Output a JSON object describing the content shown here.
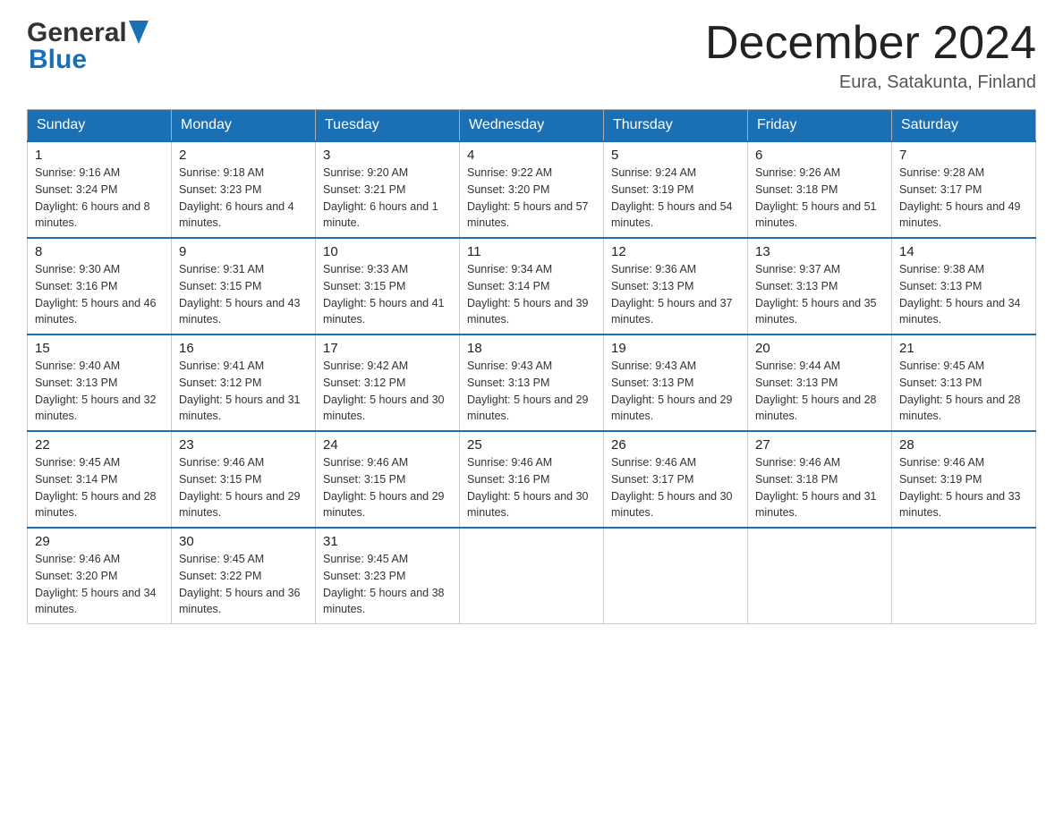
{
  "header": {
    "logo_general": "General",
    "logo_blue": "Blue",
    "month_title": "December 2024",
    "location": "Eura, Satakunta, Finland"
  },
  "days_of_week": [
    "Sunday",
    "Monday",
    "Tuesday",
    "Wednesday",
    "Thursday",
    "Friday",
    "Saturday"
  ],
  "weeks": [
    [
      {
        "day": "1",
        "sunrise": "9:16 AM",
        "sunset": "3:24 PM",
        "daylight": "6 hours and 8 minutes."
      },
      {
        "day": "2",
        "sunrise": "9:18 AM",
        "sunset": "3:23 PM",
        "daylight": "6 hours and 4 minutes."
      },
      {
        "day": "3",
        "sunrise": "9:20 AM",
        "sunset": "3:21 PM",
        "daylight": "6 hours and 1 minute."
      },
      {
        "day": "4",
        "sunrise": "9:22 AM",
        "sunset": "3:20 PM",
        "daylight": "5 hours and 57 minutes."
      },
      {
        "day": "5",
        "sunrise": "9:24 AM",
        "sunset": "3:19 PM",
        "daylight": "5 hours and 54 minutes."
      },
      {
        "day": "6",
        "sunrise": "9:26 AM",
        "sunset": "3:18 PM",
        "daylight": "5 hours and 51 minutes."
      },
      {
        "day": "7",
        "sunrise": "9:28 AM",
        "sunset": "3:17 PM",
        "daylight": "5 hours and 49 minutes."
      }
    ],
    [
      {
        "day": "8",
        "sunrise": "9:30 AM",
        "sunset": "3:16 PM",
        "daylight": "5 hours and 46 minutes."
      },
      {
        "day": "9",
        "sunrise": "9:31 AM",
        "sunset": "3:15 PM",
        "daylight": "5 hours and 43 minutes."
      },
      {
        "day": "10",
        "sunrise": "9:33 AM",
        "sunset": "3:15 PM",
        "daylight": "5 hours and 41 minutes."
      },
      {
        "day": "11",
        "sunrise": "9:34 AM",
        "sunset": "3:14 PM",
        "daylight": "5 hours and 39 minutes."
      },
      {
        "day": "12",
        "sunrise": "9:36 AM",
        "sunset": "3:13 PM",
        "daylight": "5 hours and 37 minutes."
      },
      {
        "day": "13",
        "sunrise": "9:37 AM",
        "sunset": "3:13 PM",
        "daylight": "5 hours and 35 minutes."
      },
      {
        "day": "14",
        "sunrise": "9:38 AM",
        "sunset": "3:13 PM",
        "daylight": "5 hours and 34 minutes."
      }
    ],
    [
      {
        "day": "15",
        "sunrise": "9:40 AM",
        "sunset": "3:13 PM",
        "daylight": "5 hours and 32 minutes."
      },
      {
        "day": "16",
        "sunrise": "9:41 AM",
        "sunset": "3:12 PM",
        "daylight": "5 hours and 31 minutes."
      },
      {
        "day": "17",
        "sunrise": "9:42 AM",
        "sunset": "3:12 PM",
        "daylight": "5 hours and 30 minutes."
      },
      {
        "day": "18",
        "sunrise": "9:43 AM",
        "sunset": "3:13 PM",
        "daylight": "5 hours and 29 minutes."
      },
      {
        "day": "19",
        "sunrise": "9:43 AM",
        "sunset": "3:13 PM",
        "daylight": "5 hours and 29 minutes."
      },
      {
        "day": "20",
        "sunrise": "9:44 AM",
        "sunset": "3:13 PM",
        "daylight": "5 hours and 28 minutes."
      },
      {
        "day": "21",
        "sunrise": "9:45 AM",
        "sunset": "3:13 PM",
        "daylight": "5 hours and 28 minutes."
      }
    ],
    [
      {
        "day": "22",
        "sunrise": "9:45 AM",
        "sunset": "3:14 PM",
        "daylight": "5 hours and 28 minutes."
      },
      {
        "day": "23",
        "sunrise": "9:46 AM",
        "sunset": "3:15 PM",
        "daylight": "5 hours and 29 minutes."
      },
      {
        "day": "24",
        "sunrise": "9:46 AM",
        "sunset": "3:15 PM",
        "daylight": "5 hours and 29 minutes."
      },
      {
        "day": "25",
        "sunrise": "9:46 AM",
        "sunset": "3:16 PM",
        "daylight": "5 hours and 30 minutes."
      },
      {
        "day": "26",
        "sunrise": "9:46 AM",
        "sunset": "3:17 PM",
        "daylight": "5 hours and 30 minutes."
      },
      {
        "day": "27",
        "sunrise": "9:46 AM",
        "sunset": "3:18 PM",
        "daylight": "5 hours and 31 minutes."
      },
      {
        "day": "28",
        "sunrise": "9:46 AM",
        "sunset": "3:19 PM",
        "daylight": "5 hours and 33 minutes."
      }
    ],
    [
      {
        "day": "29",
        "sunrise": "9:46 AM",
        "sunset": "3:20 PM",
        "daylight": "5 hours and 34 minutes."
      },
      {
        "day": "30",
        "sunrise": "9:45 AM",
        "sunset": "3:22 PM",
        "daylight": "5 hours and 36 minutes."
      },
      {
        "day": "31",
        "sunrise": "9:45 AM",
        "sunset": "3:23 PM",
        "daylight": "5 hours and 38 minutes."
      },
      null,
      null,
      null,
      null
    ]
  ]
}
